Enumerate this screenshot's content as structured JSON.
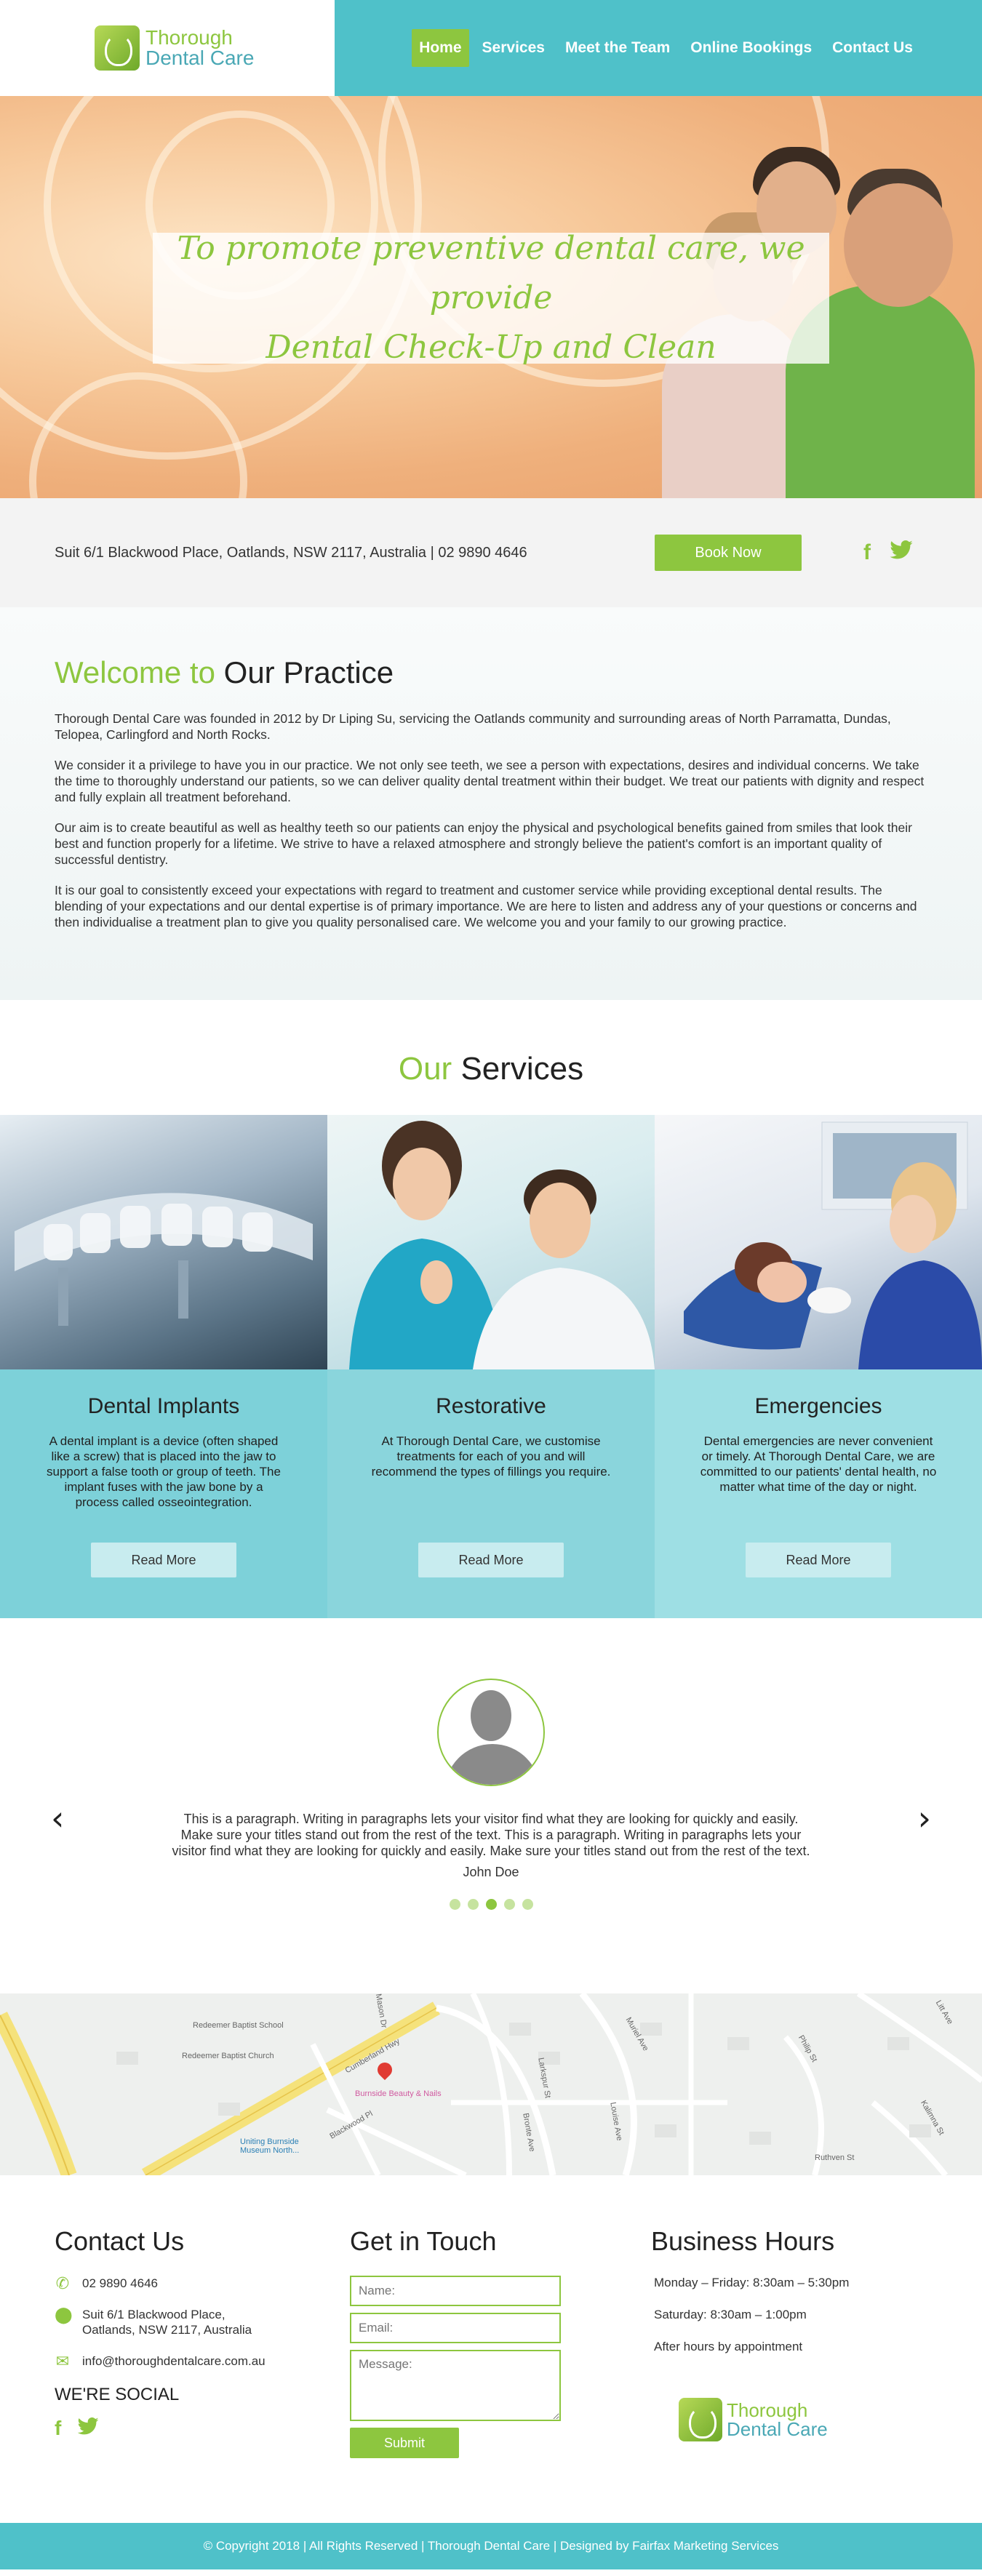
{
  "header": {
    "logo_line1": "Thorough",
    "logo_line2": "Dental Care",
    "nav": [
      {
        "label": "Home"
      },
      {
        "label": "Services"
      },
      {
        "label": "Meet the Team"
      },
      {
        "label": "Online Bookings"
      },
      {
        "label": "Contact Us"
      }
    ]
  },
  "hero": {
    "line1": "To promote preventive dental care, we provide",
    "line2": "Dental Check-Up and Clean"
  },
  "infobar": {
    "address": "Suit 6/1 Blackwood Place, Oatlands, NSW 2117, Australia | 02 9890 4646",
    "book_label": "Book Now",
    "facebook": "f",
    "twitter": "🐦"
  },
  "welcome": {
    "title_accent": "Welcome to",
    "title_rest": "Our Practice",
    "paragraphs": [
      "Thorough Dental Care was founded in 2012 by Dr Liping Su, servicing the Oatlands community and surrounding areas of North Parramatta, Dundas, Telopea, Carlingford and North Rocks.",
      "We consider it a privilege to have you in our practice. We not only see teeth, we see a person with expectations, desires and individual concerns. We take the time to thoroughly understand our patients, so we can deliver quality dental treatment within their budget. We treat our patients with dignity and respect and fully explain all treatment beforehand.",
      "Our aim is to create beautiful as well as healthy teeth so our patients can enjoy the physical and psychological benefits gained from smiles that look their best and function properly for a lifetime. We strive to have a relaxed atmosphere and strongly believe the patient's comfort is an important quality of successful dentistry.",
      "It is our goal to consistently exceed your expectations with regard to treatment and customer service while providing exceptional dental results. The blending of your expectations and our dental expertise is of primary importance. We are here to listen and address any of your questions or concerns and then individualise a treatment plan to give you quality personalised care. We welcome you and your family to our growing practice."
    ]
  },
  "services": {
    "title_accent": "Our",
    "title_rest": "Services",
    "items": [
      {
        "title": "Dental Implants",
        "text": "A dental implant is a device (often shaped like a screw) that is placed into the jaw to support a false tooth or group of teeth. The implant fuses with the jaw bone by a process called osseointegration.",
        "button": "Read More"
      },
      {
        "title": "Restorative",
        "text": "At Thorough Dental Care, we customise treatments for each of you and will recommend the types of fillings you require.",
        "button": "Read More"
      },
      {
        "title": "Emergencies",
        "text": "Dental emergencies are never convenient or timely. At Thorough Dental Care, we are committed to our patients' dental health, no matter what time of the day or night.",
        "button": "Read More"
      }
    ]
  },
  "testimonial": {
    "text": "This is a paragraph. Writing in paragraphs lets your visitor find what they are looking for quickly and easily. Make sure your titles stand out from the rest of the text. This is a paragraph. Writing in paragraphs lets your visitor find what they are looking for quickly and easily. Make sure your titles stand out from the rest of the text.",
    "name": "John Doe",
    "prev": "‹",
    "next": "›",
    "active_slide": 3,
    "slide_count": 5
  },
  "map": {
    "labels": [
      "Redeemer Baptist School",
      "Redeemer Baptist Church",
      "Cumberland Hwy",
      "Burnside Beauty & Nails",
      "Uniting Burnside Museum North...",
      "Blackwood Pl",
      "Mason Dr",
      "Larkspur St",
      "Louise Ave",
      "Muriel Ave",
      "Bronte Ave",
      "Ruthven St",
      "Kalimna St",
      "Philip St",
      "Litt Ave"
    ]
  },
  "footer": {
    "contact_title": "Contact Us",
    "phone": "02 9890 4646",
    "address_line1": "Suit 6/1 Blackwood Place,",
    "address_line2": "Oatlands, NSW 2117, Australia",
    "email": "info@thoroughdentalcare.com.au",
    "social_title": "WE'RE SOCIAL",
    "form_title": "Get in Touch",
    "name_placeholder": "Name:",
    "email_placeholder": "Email:",
    "message_placeholder": "Message:",
    "submit_label": "Submit",
    "hours_title": "Business Hours",
    "hours": [
      "Monday – Friday: 8:30am – 5:30pm",
      "Saturday: 8:30am – 1:00pm",
      "After hours by appointment"
    ]
  },
  "copyright": "© Copyright 2018 | All Rights Reserved | Thorough Dental Care | Designed by Fairfax Marketing Services",
  "colors": {
    "teal": "#4fc1c9",
    "green": "#8dc63f"
  }
}
